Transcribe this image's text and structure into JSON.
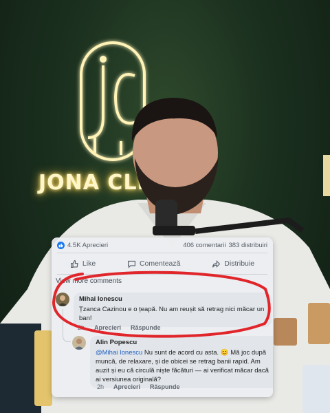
{
  "background": {
    "neon_sign_text": "JONA CLI",
    "neon_color": "#ffe27a"
  },
  "post_stats": {
    "likes": "4.5K Aprecieri",
    "comments": "406 comentarii",
    "shares": "383 distribuiri",
    "like_icon": "thumbs-up-icon"
  },
  "actions": {
    "like": "Like",
    "comment": "Comentează",
    "share": "Distribuie"
  },
  "view_more": "View more comments",
  "comments": [
    {
      "name": "Mihai Ionescu",
      "text": "Țzanca Cazinou e o țeapă. Nu am reușit să retrag nici măcar un ban!",
      "time": "2h",
      "like_label": "Aprecieri",
      "reply_label": "Răspunde"
    },
    {
      "name": "Alin Popescu",
      "mention": "@Mihai Ionescu",
      "text": " Nu sunt de acord cu asta. 😊 Mă joc după muncă, de relaxare, și de obicei se retrag banii rapid. Am auzit și eu că circulă niște făcături — ai verificat măcar dacă ai versiunea originală?",
      "time": "2h",
      "like_label": "Aprecieri",
      "reply_label": "Răspunde"
    }
  ],
  "highlight_color": "#e0262b",
  "accent": "#1877f2"
}
